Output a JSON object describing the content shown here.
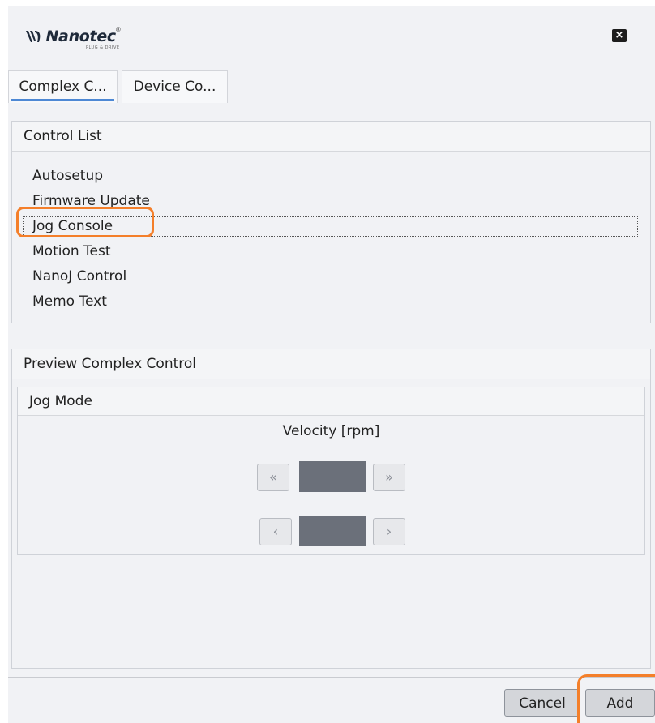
{
  "brand": {
    "name": "Nanotec",
    "registered": "®",
    "tagline": "PLUG & DRIVE",
    "icon": "nanotec-logo-icon"
  },
  "window": {
    "close_icon": "close-icon",
    "close_glyph": "×"
  },
  "tabs": [
    {
      "label": "Complex C...",
      "active": true
    },
    {
      "label": "Device Co...",
      "active": false
    }
  ],
  "control_list": {
    "title": "Control List",
    "items": [
      "Autosetup",
      "Firmware Update",
      "Jog Console",
      "Motion Test",
      "NanoJ Control",
      "Memo Text"
    ],
    "focused_index": 2
  },
  "preview": {
    "title": "Preview Complex Control",
    "jog_mode": {
      "title": "Jog Mode",
      "velocity_label": "Velocity [rpm]",
      "fast_left": "«",
      "fast_right": "»",
      "slow_left": "‹",
      "slow_right": "›"
    }
  },
  "footer": {
    "cancel_label": "Cancel",
    "add_label": "Add"
  },
  "colors": {
    "highlight": "#f47f2a",
    "tab_underline": "#4d88d4",
    "value_box": "#6b707a"
  }
}
